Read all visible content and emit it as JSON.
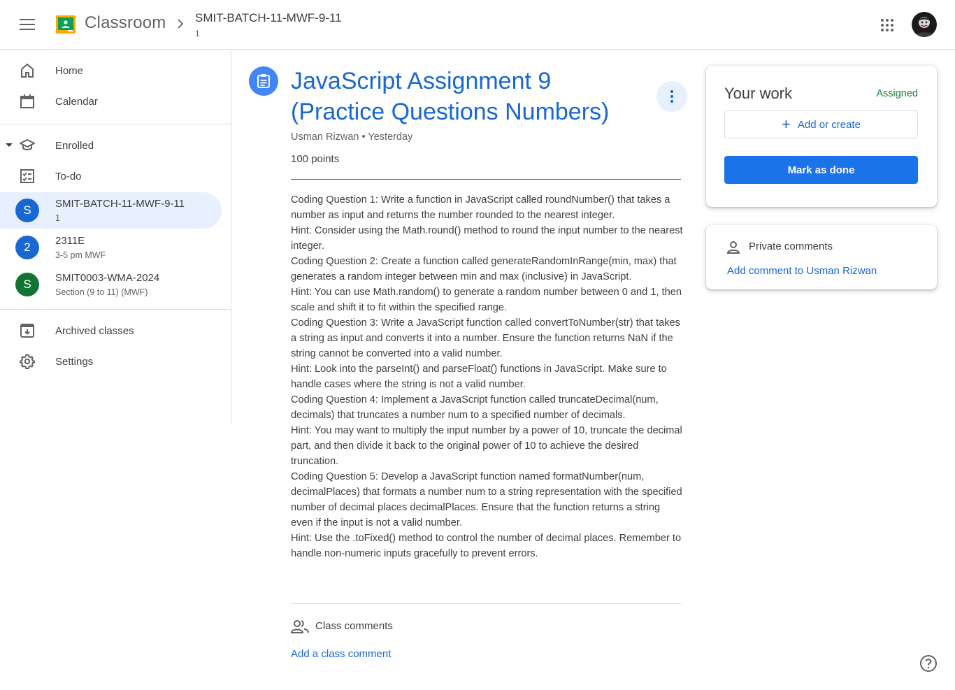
{
  "header": {
    "brand": "Classroom",
    "breadcrumb_title": "SMIT-BATCH-11-MWF-9-11",
    "breadcrumb_sub": "1"
  },
  "sidebar": {
    "home": "Home",
    "calendar": "Calendar",
    "enrolled": "Enrolled",
    "todo": "To-do",
    "classes": [
      {
        "initial": "S",
        "name": "SMIT-BATCH-11-MWF-9-11",
        "sub": "1",
        "color": "#1967d2"
      },
      {
        "initial": "2",
        "name": "2311E",
        "sub": "3-5 pm MWF",
        "color": "#1967d2"
      },
      {
        "initial": "S",
        "name": "SMIT0003-WMA-2024",
        "sub": "Section (9 to 11) (MWF)",
        "color": "#137333"
      }
    ],
    "archived": "Archived classes",
    "settings": "Settings"
  },
  "assignment": {
    "title": "JavaScript Assignment 9 (Practice Questions Numbers)",
    "author": "Usman Rizwan",
    "separator": "•",
    "time": "Yesterday",
    "points": "100 points",
    "description": [
      "Coding Question 1: Write a function in JavaScript called roundNumber() that takes a number as input and returns the number rounded to the nearest integer.",
      "Hint: Consider using the Math.round() method to round the input number to the nearest integer.",
      "Coding Question 2: Create a function called generateRandomInRange(min, max) that generates a random integer between min and max (inclusive) in JavaScript.",
      "Hint: You can use Math.random() to generate a random number between 0 and 1, then scale and shift it to fit within the specified range.",
      "Coding Question 3: Write a JavaScript function called convertToNumber(str) that takes a string as input and converts it into a number. Ensure the function returns NaN if the string cannot be converted into a valid number.",
      "Hint: Look into the parseInt() and parseFloat() functions in JavaScript. Make sure to handle cases where the string is not a valid number.",
      "Coding Question 4: Implement a JavaScript function called truncateDecimal(num, decimals) that truncates a number num to a specified number of decimals.",
      "Hint: You may want to multiply the input number by a power of 10, truncate the decimal part, and then divide it back to the original power of 10 to achieve the desired truncation.",
      "Coding Question 5: Develop a JavaScript function named formatNumber(num, decimalPlaces) that formats a number num to a string representation with the specified number of decimal places decimalPlaces. Ensure that the function returns a string even if the input is not a valid number.",
      "Hint: Use the .toFixed() method to control the number of decimal places. Remember to handle non-numeric inputs gracefully to prevent errors."
    ],
    "class_comments_label": "Class comments",
    "add_class_comment": "Add a class comment"
  },
  "your_work": {
    "title": "Your work",
    "status": "Assigned",
    "add_or_create": "Add or create",
    "mark_as_done": "Mark as done"
  },
  "private_comments": {
    "label": "Private comments",
    "add_link": "Add comment to Usman Rizwan"
  },
  "colors": {
    "accent": "#1967d2",
    "primary_button": "#1a73e8",
    "assigned_status": "#188038",
    "active_class_bg": "#e8f0fe"
  }
}
